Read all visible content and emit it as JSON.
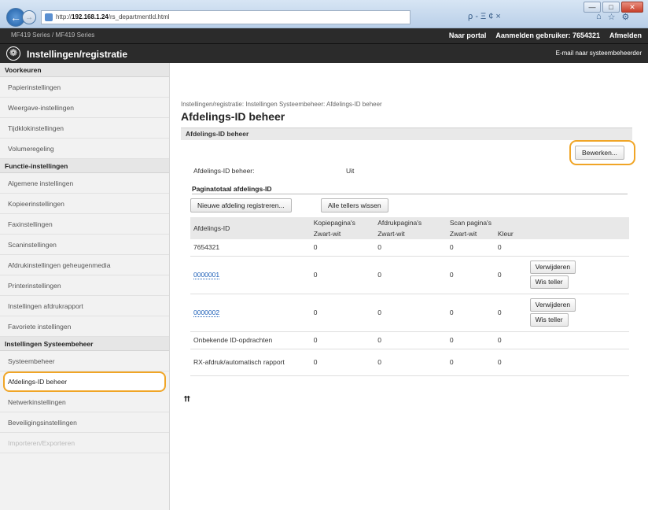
{
  "browser": {
    "url_prefix": "http://",
    "url_host": "192.168.1.24",
    "url_path": "/rs_departmentId.html",
    "search_glyphs": "ρ - Ξ ¢ ×",
    "tool_icons": [
      "home-icon",
      "star-icon",
      "gear-icon"
    ],
    "window_buttons": [
      "—",
      "□",
      "✕"
    ]
  },
  "header": {
    "device_name": "MF419 Series / MF419 Series",
    "portal_link": "Naar portal",
    "login_label": "Aanmelden gebruiker: 7654321",
    "logout_link": "Afmelden",
    "app_title": "Instellingen/registratie",
    "mail_admin": "E-mail naar systeembeheerder"
  },
  "sidebar": {
    "sections": [
      {
        "title": "Voorkeuren",
        "items": [
          "Papierinstellingen",
          "Weergave-instellingen",
          "Tijdklokinstellingen",
          "Volumeregeling"
        ]
      },
      {
        "title": "Functie-instellingen",
        "items": [
          "Algemene instellingen",
          "Kopieerinstellingen",
          "Faxinstellingen",
          "Scaninstellingen",
          "Afdrukinstellingen geheugenmedia",
          "Printerinstellingen",
          "Instellingen afdrukrapport",
          "Favoriete instellingen"
        ]
      },
      {
        "title": "Instellingen Systeembeheer",
        "items": [
          "Systeembeheer",
          "Afdelings-ID beheer",
          "Netwerkinstellingen",
          "Beveiligingsinstellingen",
          "Importeren/Exporteren"
        ]
      }
    ],
    "active_item": "Afdelings-ID beheer"
  },
  "main": {
    "breadcrumb": "Instellingen/registratie: Instellingen Systeembeheer: Afdelings-ID beheer",
    "page_title": "Afdelings-ID beheer",
    "section_title": "Afdelings-ID beheer",
    "edit_button": "Bewerken...",
    "setting_label": "Afdelings-ID beheer:",
    "setting_value": "Uit",
    "subsection_title": "Paginatotaal afdelings-ID",
    "register_button": "Nieuwe afdeling registreren...",
    "clear_all_button": "Alle tellers wissen",
    "table": {
      "col_id": "Afdelings-ID",
      "groups": [
        "Kopiepagina's",
        "Afdrukpagina's",
        "Scan pagina's"
      ],
      "sub_cols": [
        "Zwart-wit",
        "Zwart-wit",
        "Zwart-wit",
        "Kleur"
      ],
      "rows": [
        {
          "id": "7654321",
          "link": false,
          "values": [
            "0",
            "0",
            "0",
            "0"
          ],
          "buttons": []
        },
        {
          "id": "0000001",
          "link": true,
          "values": [
            "0",
            "0",
            "0",
            "0"
          ],
          "buttons": [
            "Verwijderen",
            "Wis teller"
          ]
        },
        {
          "id": "0000002",
          "link": true,
          "values": [
            "0",
            "0",
            "0",
            "0"
          ],
          "buttons": [
            "Verwijderen",
            "Wis teller"
          ]
        },
        {
          "id": "Onbekende ID-opdrachten",
          "link": false,
          "values": [
            "0",
            "0",
            "0",
            "0"
          ],
          "buttons": []
        },
        {
          "id": "RX-afdruk/automatisch rapport",
          "link": false,
          "values": [
            "0",
            "0",
            "0",
            "0"
          ],
          "buttons": []
        }
      ]
    },
    "to_top_glyph": "⮅"
  }
}
